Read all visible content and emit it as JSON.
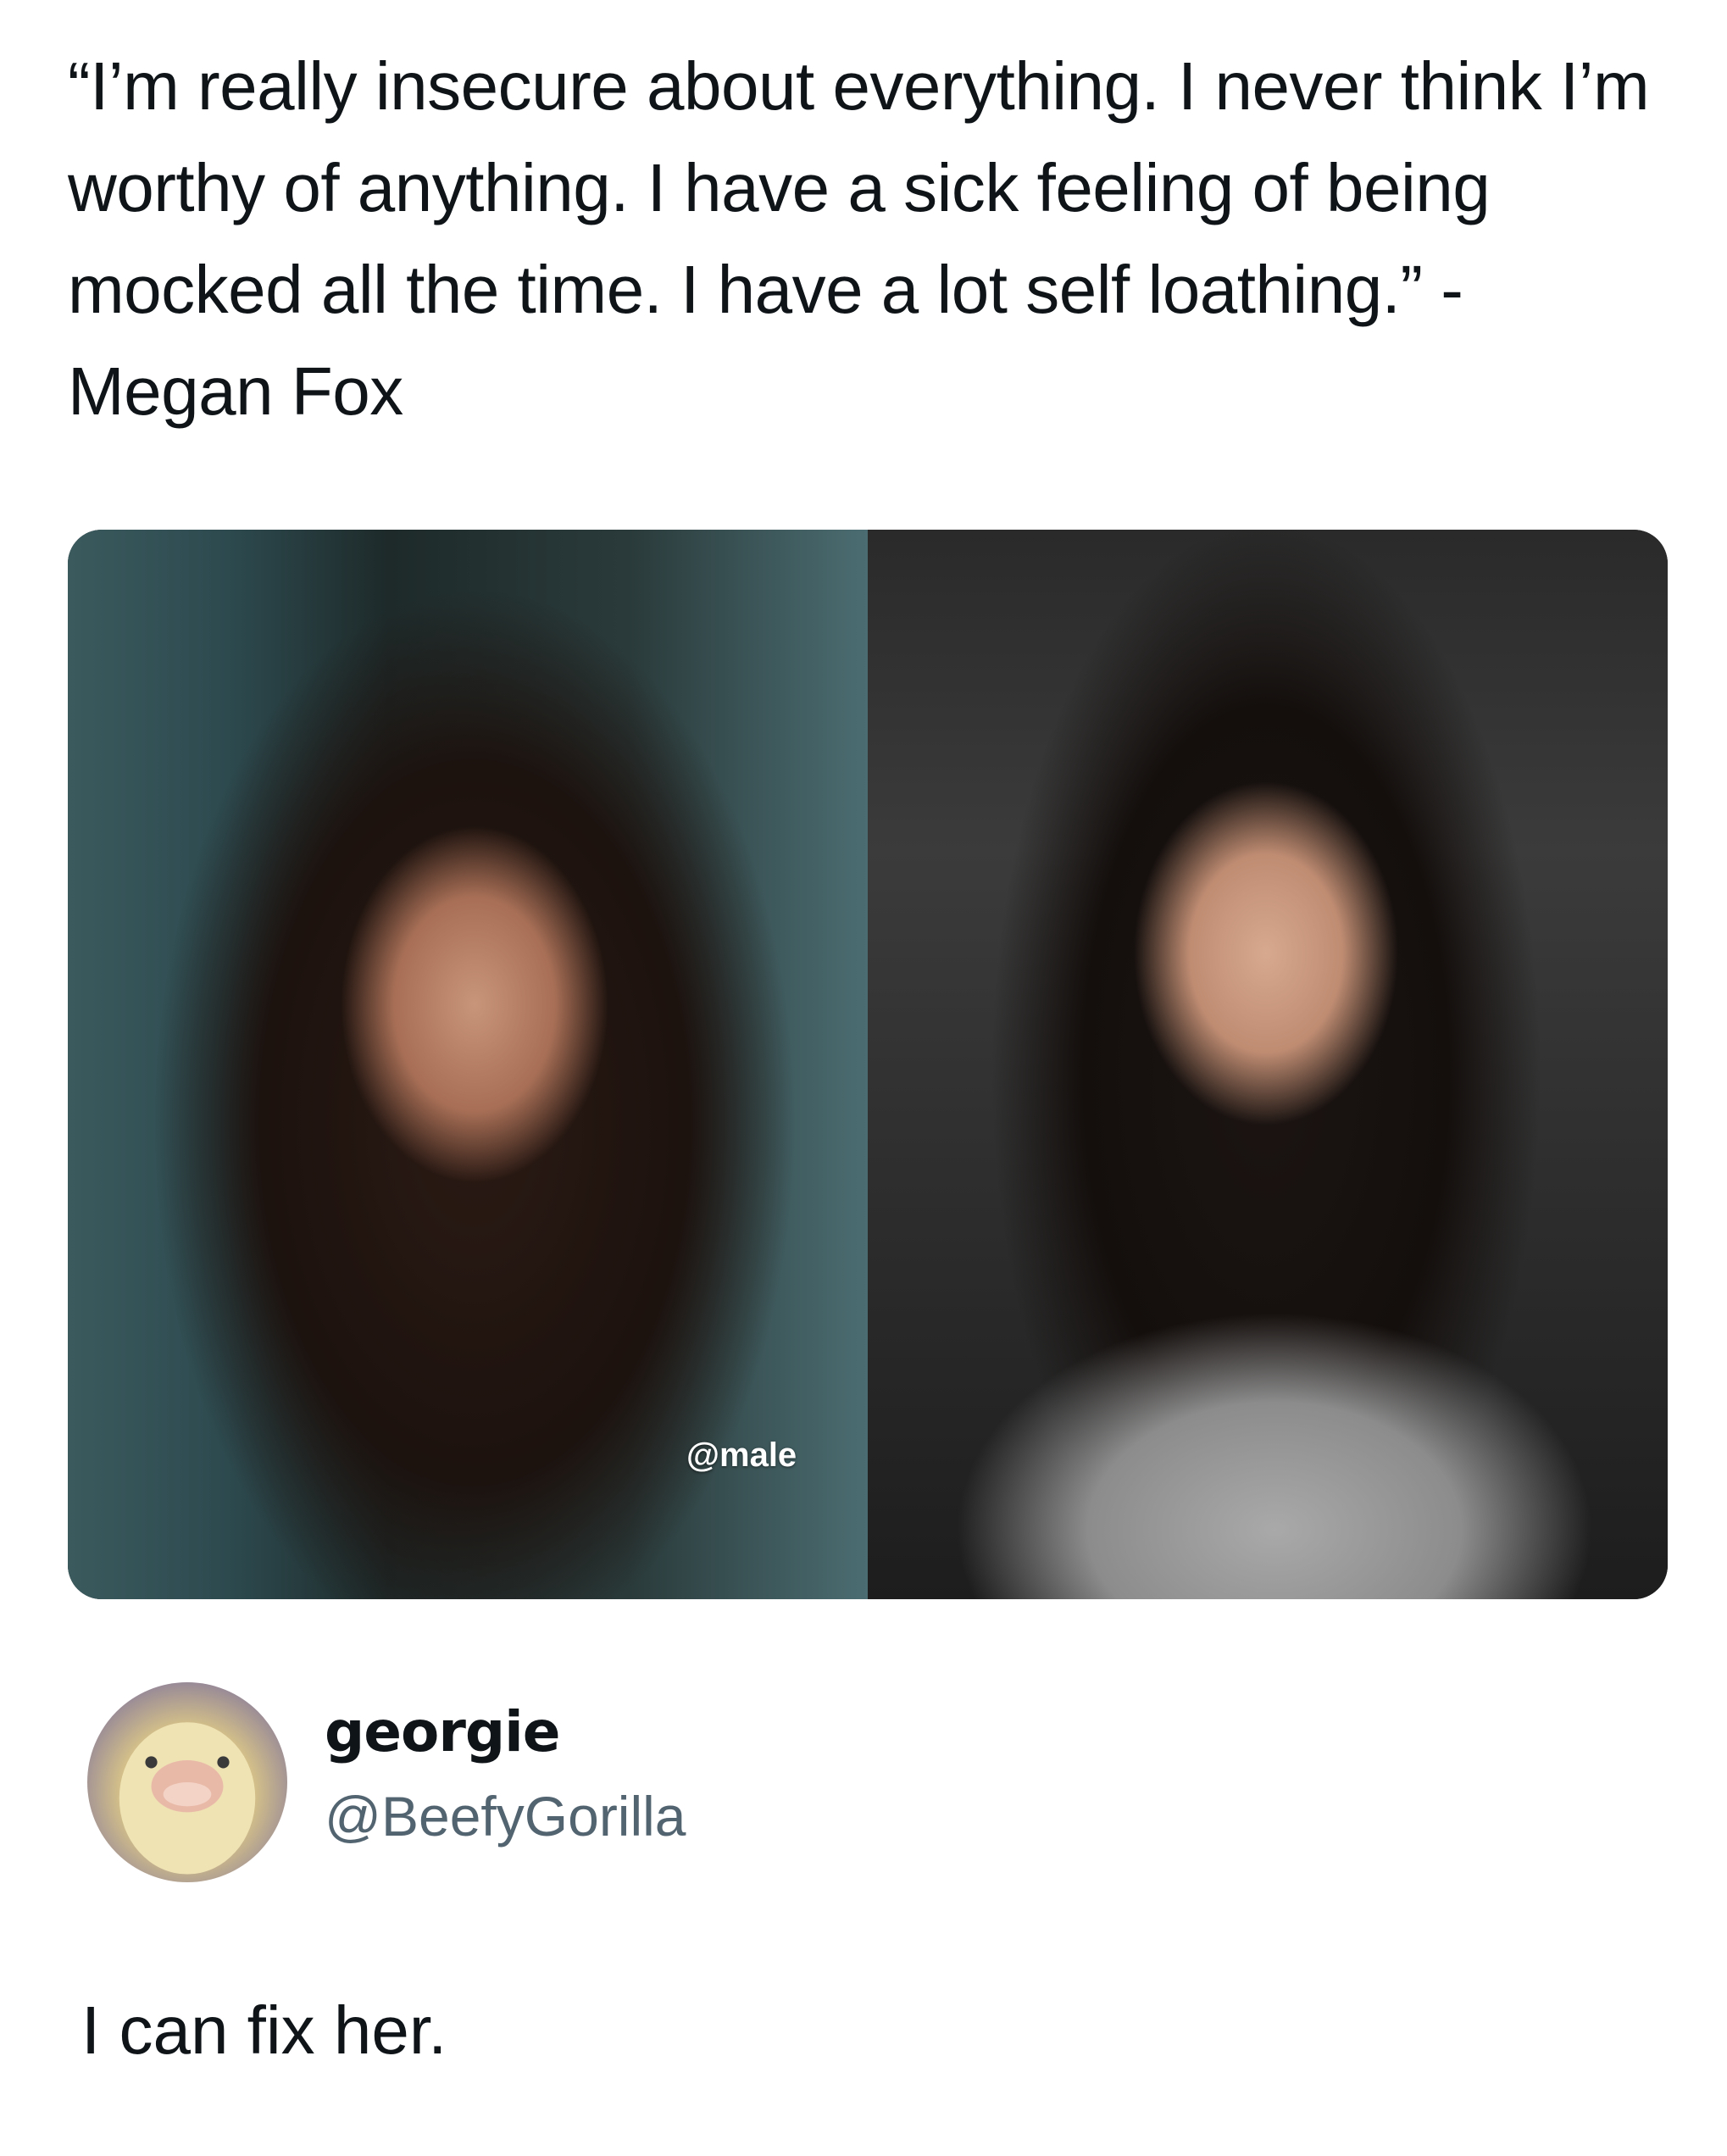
{
  "tweet": {
    "quote_text": "“I’m really insecure about everything. I never think I’m worthy of anything. I have a sick feeling of being mocked all the time. I have a lot self loathing.” - Megan Fox"
  },
  "media": {
    "watermark": "@male"
  },
  "reply": {
    "display_name": "georgie",
    "handle": "@BeefyGorilla",
    "text": "I can fix her."
  },
  "colors": {
    "text_primary": "#0f1419",
    "text_secondary": "#536471",
    "background": "#ffffff"
  }
}
